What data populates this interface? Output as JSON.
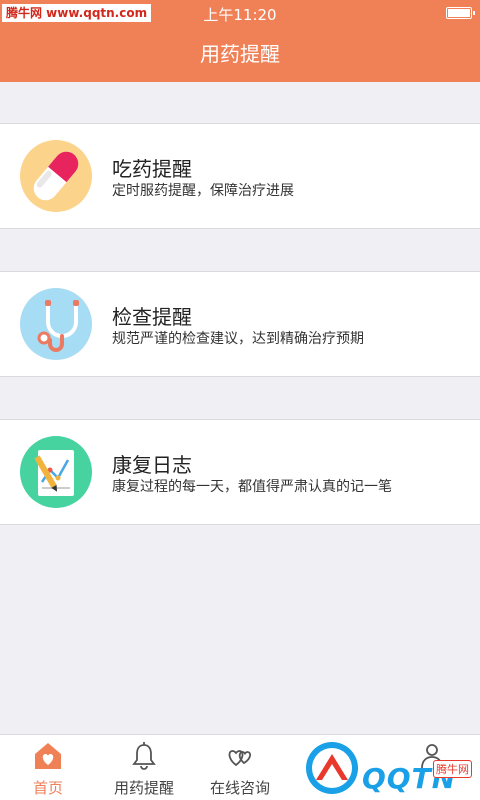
{
  "status_bar": {
    "time": "上午11:20",
    "watermark": "腾牛网 www.qqtn.com"
  },
  "header": {
    "title": "用药提醒"
  },
  "cards": [
    {
      "title": "吃药提醒",
      "subtitle": "定时服药提醒，保障治疗进展",
      "icon": "pill-icon"
    },
    {
      "title": "检查提醒",
      "subtitle": "规范严谨的检查建议，达到精确治疗预期",
      "icon": "stethoscope-icon"
    },
    {
      "title": "康复日志",
      "subtitle": "康复过程的每一天，都值得严肃认真的记一笔",
      "icon": "chart-document-icon"
    }
  ],
  "tabs": [
    {
      "label": "首页",
      "icon": "home-heart-icon",
      "active": true
    },
    {
      "label": "用药提醒",
      "icon": "bell-icon",
      "active": false
    },
    {
      "label": "在线咨询",
      "icon": "hearts-icon",
      "active": false
    }
  ],
  "watermark_br": {
    "text": "QQTN",
    "tag": "腾牛网"
  },
  "colors": {
    "accent": "#f08157",
    "background": "#efeff4"
  }
}
